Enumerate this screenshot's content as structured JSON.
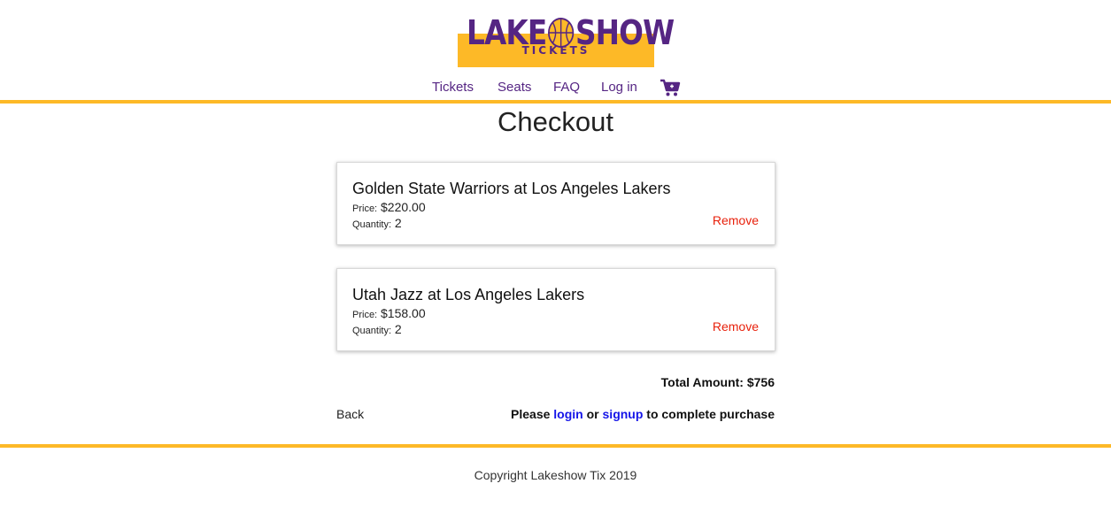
{
  "logo": {
    "top_text_left": "LAKE",
    "top_text_right": "SHOW",
    "sub_text": "TICKETS"
  },
  "nav": {
    "items": [
      {
        "label": "Tickets"
      },
      {
        "label": "Seats"
      },
      {
        "label": "FAQ"
      },
      {
        "label": "Log in"
      }
    ],
    "cart_icon": "shopping-cart-icon"
  },
  "page": {
    "title": "Checkout"
  },
  "cart": {
    "items": [
      {
        "title": "Golden State Warriors at Los Angeles Lakers",
        "price_label": "Price:",
        "price": "$220.00",
        "quantity_label": "Quantity:",
        "quantity": "2",
        "remove_label": "Remove"
      },
      {
        "title": "Utah Jazz at Los Angeles Lakers",
        "price_label": "Price:",
        "price": "$158.00",
        "quantity_label": "Quantity:",
        "quantity": "2",
        "remove_label": "Remove"
      }
    ],
    "total_label": "Total Amount:",
    "total_value": "$756"
  },
  "actions": {
    "back_label": "Back",
    "prompt_prefix": "Please",
    "login_label": "login",
    "prompt_or": "or",
    "signup_label": "signup",
    "prompt_suffix": "to complete purchase"
  },
  "footer": {
    "copyright": "Copyright Lakeshow Tix 2019"
  },
  "colors": {
    "brand_purple": "#552583",
    "brand_gold": "#fdb927",
    "remove_red": "#e8210c",
    "link_blue": "#1515e8"
  }
}
